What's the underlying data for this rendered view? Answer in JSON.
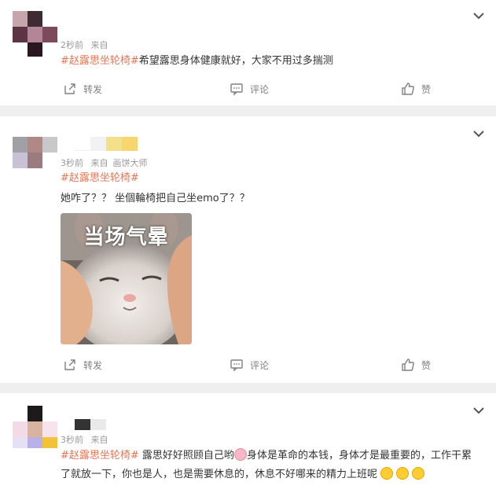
{
  "actions": {
    "share": "转发",
    "comment": "评论",
    "like": "赞"
  },
  "posts": [
    {
      "meta": {
        "time": "2秒前",
        "source": "来自"
      },
      "hashtag": "#赵露思坐轮椅#",
      "text": "希望露思身体健康就好，大家不用过多揣测"
    },
    {
      "meta": {
        "time": "3秒前",
        "source": "来自",
        "client": "画饼大师"
      },
      "hashtag": "#赵露思坐轮椅#",
      "text": "她咋了？？ 坐個輪椅把自己坐emo了？？",
      "image_caption": "当场气晕"
    },
    {
      "meta": {
        "time": "3秒前",
        "source": "来自"
      },
      "hashtag": "#赵露思坐轮椅#",
      "text_a": " 露思好好照顾自己哟",
      "text_b": "身体是革命的本钱，身体才是最重要的，工作干累了就放一下，你也是人，也是需要休息的，休息不好哪来的精力上班呢"
    }
  ],
  "colors": {
    "hashtag": "#eb7350",
    "meta": "#999999",
    "action": "#808080",
    "divider": "#efefef"
  },
  "icons": {
    "share": "share-icon",
    "comment": "comment-icon",
    "like": "thumbs-up-icon",
    "more": "chevron-down-icon"
  }
}
